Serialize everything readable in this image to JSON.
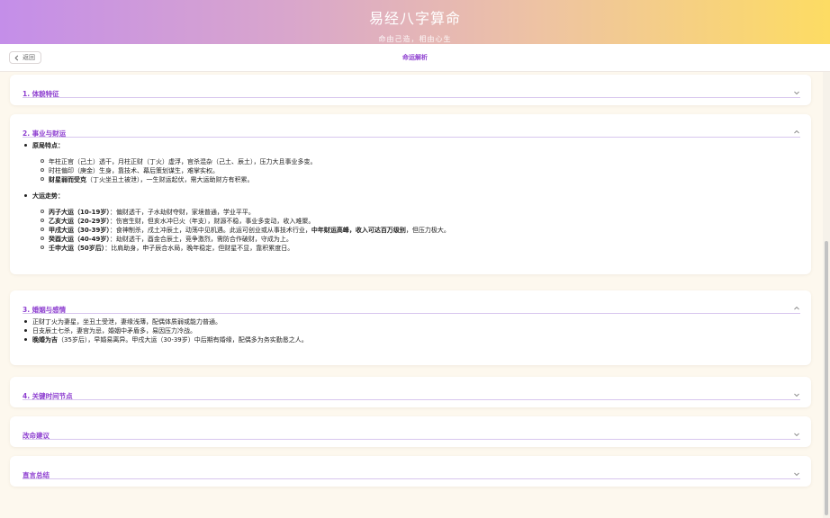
{
  "banner": {
    "title": "易经八字算命",
    "subtitle": "命由己造，相由心生"
  },
  "navbar": {
    "back_label": "返回",
    "title": "命运解析"
  },
  "sections": {
    "body": {
      "title": "1. 体貌特征",
      "state": "collapsed"
    },
    "career": {
      "title": "2. 事业与财运",
      "state": "expanded",
      "origin_label": "原局特点：",
      "origin_items": [
        {
          "bold": "",
          "text": "年柱正官（己土）透干，月柱正财（丁火）虚浮，官杀混杂（己土、辰土），压力大且事业多变。"
        },
        {
          "bold": "",
          "text": "时柱偏印（庚金）生身，靠技术、幕后策划谋生，难掌实权。"
        },
        {
          "bold": "财星弱而受克",
          "text": "（丁火坐丑土被泄），一生财运起伏，需大运助财方有积累。"
        }
      ],
      "luck_label": "大运走势：",
      "luck_items": [
        {
          "bold": "丙子大运（10-19岁）",
          "text": "：偏财透干，子水劫财夺财，家境普通，学业平平。"
        },
        {
          "bold": "乙亥大运（20-29岁）",
          "text": "：伤官生财，但亥水冲巳火（年支），财源不稳，事业多变动，收入难聚。"
        },
        {
          "bold": "甲戌大运（30-39岁）",
          "text": "：食神制杀，戌土冲辰土，动荡中见机遇。此运可创业或从事技术行业，",
          "bold2": "中年财运高峰，收入可达百万级别",
          "text2": "，但压力极大。"
        },
        {
          "bold": "癸酉大运（40-49岁）",
          "text": "：劫财透干，酉金合辰土，竞争激烈，需防合作破财，守成为上。"
        },
        {
          "bold": "壬申大运（50岁后）",
          "text": "：比肩助身，申子辰合水局，晚年稳定，但财星不显，靠积累度日。"
        }
      ]
    },
    "marriage": {
      "title": "3. 婚姻与感情",
      "state": "expanded",
      "items": [
        {
          "bold": "",
          "text": "正财丁火为妻星，坐丑土受泄，妻缘浅薄，配偶体质弱或能力普通。"
        },
        {
          "bold": "",
          "text": "日支辰土七杀，妻宫为忌，婚姻中矛盾多，易因压力冷战。"
        },
        {
          "bold": "晚婚为吉",
          "text": "（35岁后），早婚易离异。甲戌大运（30-39岁）中后期有婚缘，配偶多为务实勤恳之人。"
        }
      ]
    },
    "timeline": {
      "title": "4. 关键时间节点",
      "state": "collapsed"
    },
    "advice": {
      "title": "改命建议",
      "state": "collapsed"
    },
    "summary": {
      "title": "直言总结",
      "state": "collapsed"
    }
  },
  "colors": {
    "accent": "#8e3fd0",
    "header_border": "#d8c6ee",
    "page_bg": "#fdf8ee"
  },
  "icons": {
    "back": "chevron-left-icon",
    "collapsed": "chevron-down-icon",
    "expanded": "chevron-up-icon"
  }
}
